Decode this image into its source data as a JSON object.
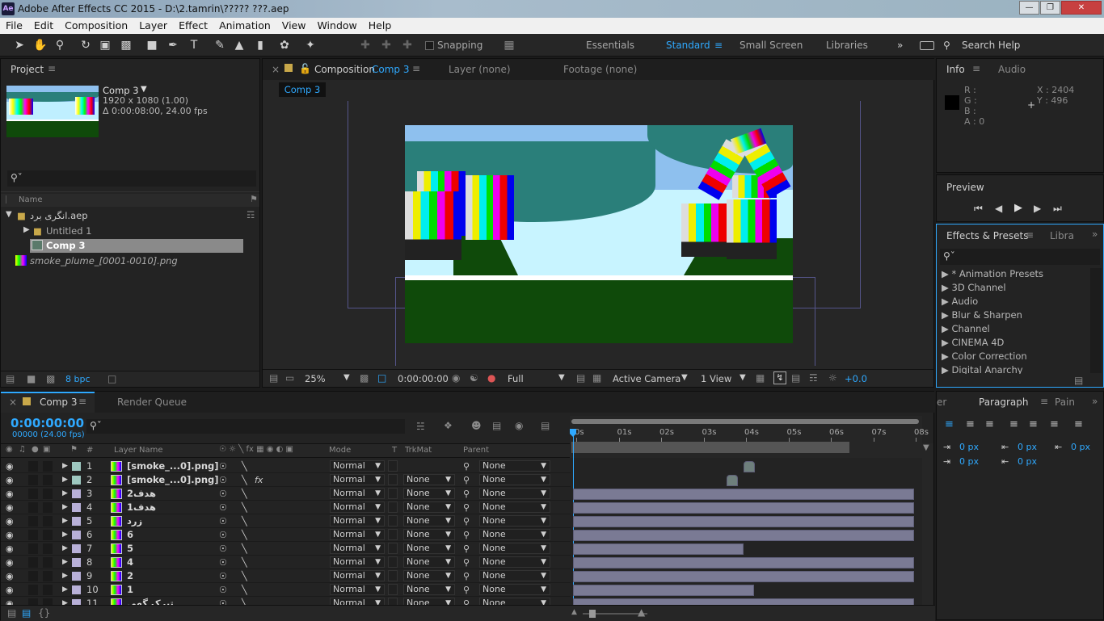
{
  "titlebar": {
    "title": "Adobe After Effects CC 2015 - D:\\2.tamrin\\????? ???.aep",
    "logo": "Ae"
  },
  "menu": [
    "File",
    "Edit",
    "Composition",
    "Layer",
    "Effect",
    "Animation",
    "View",
    "Window",
    "Help"
  ],
  "toolbar": {
    "snapping": "Snapping",
    "workspaces": [
      "Essentials",
      "Standard",
      "Small Screen",
      "Libraries"
    ],
    "active_workspace": "Standard",
    "search": "Search Help"
  },
  "project": {
    "title": "Project",
    "comp_name": "Comp 3",
    "comp_size": "1920 x 1080 (1.00)",
    "comp_duration": "Δ 0:00:08:00, 24.00 fps",
    "col_name": "Name",
    "bpc": "8 bpc",
    "items": [
      {
        "name": "انگری برد.aep",
        "indent": 0
      },
      {
        "name": "Untitled 1",
        "indent": 1
      },
      {
        "name": "Comp 3",
        "indent": 2
      },
      {
        "name": "smoke_plume_[0001-0010].png",
        "indent": 0
      }
    ]
  },
  "viewer": {
    "tab_comp": "Composition",
    "tab_comp_name": "Comp 3",
    "tab_layer": "Layer (none)",
    "tab_footage": "Footage (none)",
    "crumb": "Comp 3",
    "zoom": "25%",
    "time": "0:00:00:00",
    "resolution": "Full",
    "camera": "Active Camera",
    "views": "1 View",
    "exposure": "+0.0"
  },
  "info": {
    "title": "Info",
    "tab2": "Audio",
    "r": "R :",
    "g": "G :",
    "b": "B :",
    "a": "A : 0",
    "x": "X : 2404",
    "y": "Y : 496"
  },
  "preview": {
    "title": "Preview"
  },
  "effects": {
    "title": "Effects & Presets",
    "tab2": "Libra",
    "items": [
      "* Animation Presets",
      "3D Channel",
      "Audio",
      "Blur & Sharpen",
      "Channel",
      "CINEMA 4D",
      "Color Correction",
      "Digital Anarchy"
    ]
  },
  "paragraph": {
    "tab0": "er",
    "title": "Paragraph",
    "tab2": "Pain",
    "v1": "0 px",
    "v2": "0 px",
    "v3": "0 px",
    "v4": "0 px",
    "v5": "0 px"
  },
  "timeline": {
    "tab": "Comp 3",
    "tab2": "Render Queue",
    "timecode": "0:00:00:00",
    "frames": "00000 (24.00 fps)",
    "headers": {
      "num": "#",
      "layer": "Layer Name",
      "mode": "Mode",
      "t": "T",
      "trkmat": "TrkMat",
      "parent": "Parent"
    },
    "ruler": [
      "0s",
      "01s",
      "02s",
      "03s",
      "04s",
      "05s",
      "06s",
      "07s",
      "08s"
    ],
    "layers": [
      {
        "n": "1",
        "name": "[smoke_...0].png]",
        "mode": "Normal",
        "trk": "",
        "parent": "None",
        "color": "#9ec8c0",
        "fx": false,
        "bar_start": 0.5,
        "bar_end": 0.52
      },
      {
        "n": "2",
        "name": "[smoke_...0].png]",
        "mode": "Normal",
        "trk": "None",
        "parent": "None",
        "color": "#9ec8c0",
        "fx": true,
        "bar_start": 0.45,
        "bar_end": 0.47
      },
      {
        "n": "3",
        "name": "هدف2",
        "mode": "Normal",
        "trk": "None",
        "parent": "None",
        "color": "#b8b0d8",
        "fx": false,
        "bar_start": 0,
        "bar_end": 1
      },
      {
        "n": "4",
        "name": "هدف1",
        "mode": "Normal",
        "trk": "None",
        "parent": "None",
        "color": "#b8b0d8",
        "fx": false,
        "bar_start": 0,
        "bar_end": 1
      },
      {
        "n": "5",
        "name": "زرد",
        "mode": "Normal",
        "trk": "None",
        "parent": "None",
        "color": "#b8b0d8",
        "fx": false,
        "bar_start": 0,
        "bar_end": 1
      },
      {
        "n": "6",
        "name": "6",
        "mode": "Normal",
        "trk": "None",
        "parent": "None",
        "color": "#b8b0d8",
        "fx": false,
        "bar_start": 0,
        "bar_end": 1
      },
      {
        "n": "7",
        "name": "5",
        "mode": "Normal",
        "trk": "None",
        "parent": "None",
        "color": "#b8b0d8",
        "fx": false,
        "bar_start": 0,
        "bar_end": 0.5
      },
      {
        "n": "8",
        "name": "4",
        "mode": "Normal",
        "trk": "None",
        "parent": "None",
        "color": "#b8b0d8",
        "fx": false,
        "bar_start": 0,
        "bar_end": 1
      },
      {
        "n": "9",
        "name": "2",
        "mode": "Normal",
        "trk": "None",
        "parent": "None",
        "color": "#b8b0d8",
        "fx": false,
        "bar_start": 0,
        "bar_end": 1
      },
      {
        "n": "10",
        "name": "1",
        "mode": "Normal",
        "trk": "None",
        "parent": "None",
        "color": "#b8b0d8",
        "fx": false,
        "bar_start": 0,
        "bar_end": 0.53
      },
      {
        "n": "11",
        "name": "تیرک گهی",
        "mode": "Normal",
        "trk": "None",
        "parent": "None",
        "color": "#b8b0d8",
        "fx": false,
        "bar_start": 0,
        "bar_end": 1
      }
    ]
  },
  "colors": {
    "accent": "#2fa9ff",
    "bg": "#232323",
    "sky": "#8ec0ee",
    "ground": "#0f4a0a"
  }
}
